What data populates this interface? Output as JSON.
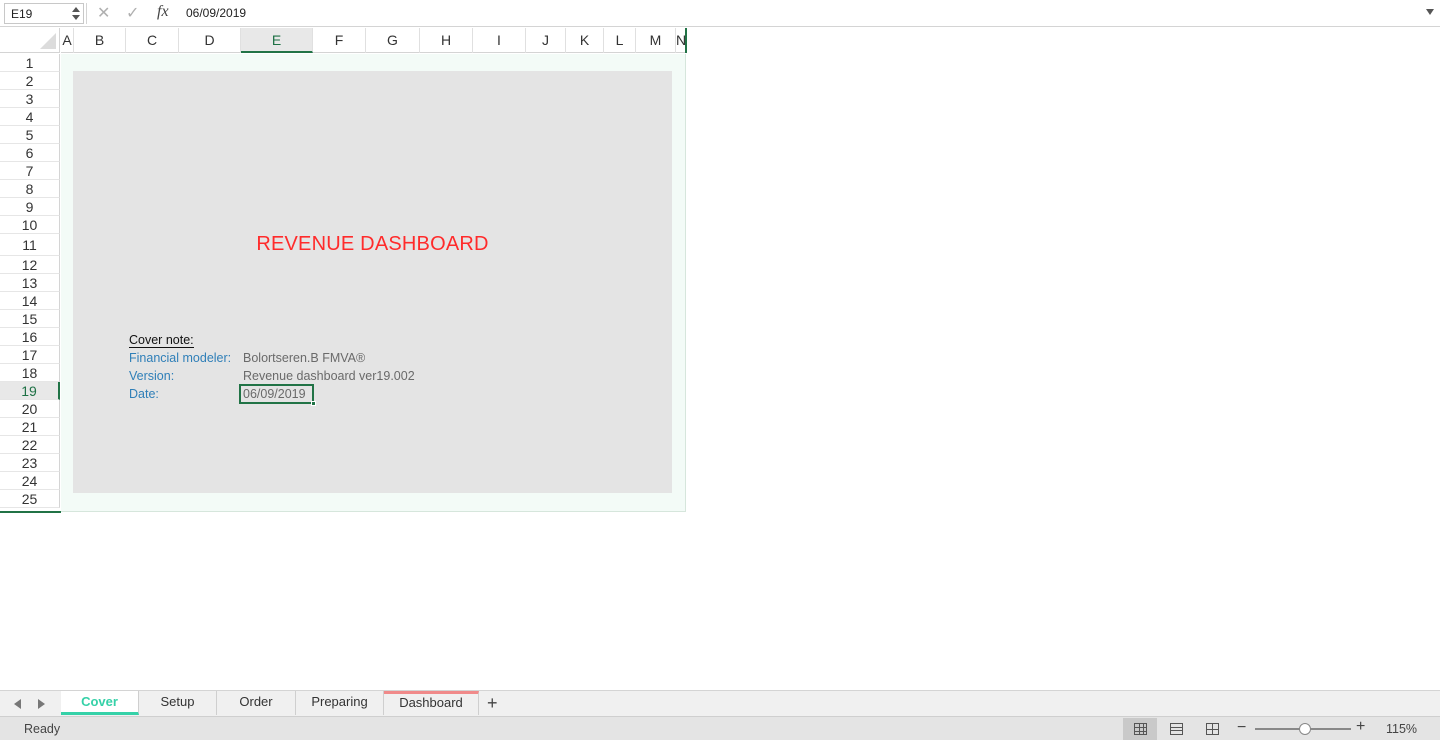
{
  "formula_bar": {
    "name_box": "E19",
    "cancel_icon": "✕",
    "enter_icon": "✓",
    "fx_label": "fx",
    "formula_value": "06/09/2019"
  },
  "grid": {
    "columns": [
      "A",
      "B",
      "C",
      "D",
      "E",
      "F",
      "G",
      "H",
      "I",
      "J",
      "K",
      "L",
      "M",
      "N"
    ],
    "selected_column": "E",
    "rows": [
      "1",
      "2",
      "3",
      "4",
      "5",
      "6",
      "7",
      "8",
      "9",
      "10",
      "11",
      "12",
      "13",
      "14",
      "15",
      "16",
      "17",
      "18",
      "19",
      "20",
      "21",
      "22",
      "23",
      "24",
      "25"
    ],
    "selected_row": "19"
  },
  "cover": {
    "title": "REVENUE DASHBOARD",
    "title_color": "#ff2b2b",
    "note_label": "Cover note:",
    "fields": [
      {
        "label": "Financial modeler:",
        "value": "Bolortseren.B FMVA®"
      },
      {
        "label": "Version:",
        "value": "Revenue dashboard ver19.002"
      },
      {
        "label": "Date:",
        "value": "06/09/2019"
      }
    ]
  },
  "sheet_tabs": [
    {
      "label": "Cover",
      "active": true
    },
    {
      "label": "Setup",
      "active": false
    },
    {
      "label": "Order",
      "active": false
    },
    {
      "label": "Preparing",
      "active": false
    },
    {
      "label": "Dashboard",
      "active": false,
      "tab_color": "#f08a8a"
    }
  ],
  "add_sheet_label": "+",
  "status_bar": {
    "status": "Ready",
    "zoom_out": "−",
    "zoom_in": "+",
    "zoom_level": "115%",
    "zoom_fraction": 0.52,
    "views": [
      "normal-view-icon",
      "page-layout-view-icon",
      "page-break-view-icon"
    ]
  },
  "colors": {
    "accent_green": "#217346",
    "active_tab": "#35d1a8",
    "label_blue": "#2f7fb8"
  }
}
